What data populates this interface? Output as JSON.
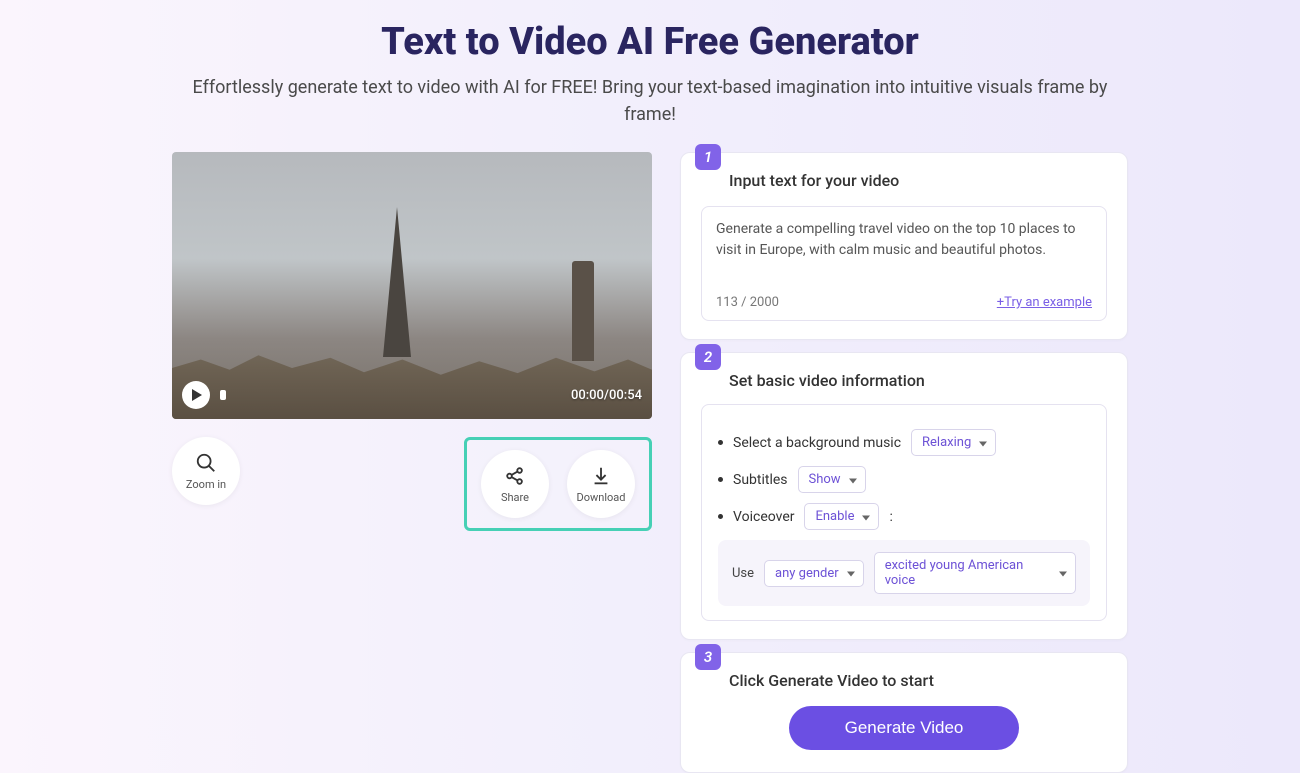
{
  "header": {
    "title": "Text to Video AI Free Generator",
    "subtitle": "Effortlessly generate text to video with AI for FREE! Bring your text-based imagination into intuitive visuals frame by frame!"
  },
  "video": {
    "current_time": "00:00",
    "duration": "00:54",
    "time_display": "00:00/00:54"
  },
  "left_actions": {
    "zoom_label": "Zoom in",
    "share_label": "Share",
    "download_label": "Download"
  },
  "step1": {
    "badge": "1",
    "title": "Input text for your video",
    "prompt_text": "Generate a compelling travel video on the top 10 places to visit in Europe, with calm music and beautiful photos.",
    "char_count": "113",
    "char_max": "2000",
    "counter_display": "113 / 2000",
    "example_link": "+Try an example"
  },
  "step2": {
    "badge": "2",
    "title": "Set basic video information",
    "bg_music_label": "Select a background music",
    "bg_music_value": "Relaxing",
    "subtitles_label": "Subtitles",
    "subtitles_value": "Show",
    "voiceover_label": "Voiceover",
    "voiceover_value": "Enable",
    "voiceover_colon": ":",
    "use_label": "Use",
    "gender_value": "any gender",
    "voice_value": "excited young American voice"
  },
  "step3": {
    "badge": "3",
    "title": "Click Generate Video to start",
    "button_label": "Generate Video"
  }
}
